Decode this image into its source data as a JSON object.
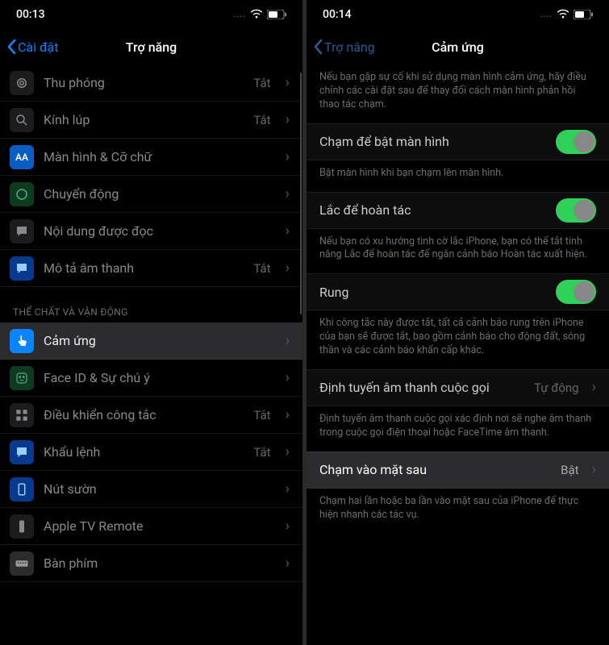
{
  "left": {
    "time": "00:13",
    "back": "Cài đặt",
    "title": "Trợ năng",
    "section_header": "THỂ CHẤT VÀ VẬN ĐỘNG",
    "rows": [
      {
        "icon": "zoom",
        "label": "Thu phóng",
        "value": "Tắt"
      },
      {
        "icon": "loup",
        "label": "Kính lúp",
        "value": "Tắt"
      },
      {
        "icon": "text",
        "label": "Màn hình & Cỡ chữ",
        "value": ""
      },
      {
        "icon": "motion",
        "label": "Chuyển động",
        "value": ""
      },
      {
        "icon": "spoken",
        "label": "Nội dung được đọc",
        "value": ""
      },
      {
        "icon": "audio",
        "label": "Mô tả âm thanh",
        "value": "Tắt"
      }
    ],
    "rows2": [
      {
        "icon": "touch",
        "label": "Cảm ứng",
        "value": "",
        "hl": true
      },
      {
        "icon": "face",
        "label": "Face ID & Sự chú ý",
        "value": ""
      },
      {
        "icon": "switch",
        "label": "Điều khiển công tắc",
        "value": "Tắt"
      },
      {
        "icon": "voice",
        "label": "Khẩu lệnh",
        "value": "Tắt"
      },
      {
        "icon": "side",
        "label": "Nút sườn",
        "value": ""
      },
      {
        "icon": "tv",
        "label": "Apple TV Remote",
        "value": ""
      },
      {
        "icon": "kb",
        "label": "Bàn phím",
        "value": ""
      }
    ]
  },
  "right": {
    "time": "00:14",
    "back": "Trợ năng",
    "title": "Cảm ứng",
    "intro": "Nếu bạn gặp sự cố khi sử dụng màn hình cảm ứng, hãy điều chỉnh các cài đặt sau để thay đổi cách màn hình phản hồi thao tác chạm.",
    "tap_wake_label": "Chạm để bật màn hình",
    "tap_wake_desc": "Bật màn hình khi bạn chạm lên màn hình.",
    "shake_label": "Lắc để hoàn tác",
    "shake_desc": "Nếu bạn có xu hướng tình cờ lắc iPhone, bạn có thể tắt tính năng Lắc để hoàn tác để ngăn cảnh báo Hoàn tác xuất hiện.",
    "vibe_label": "Rung",
    "vibe_desc": "Khi công tắc này được tắt, tất cả cảnh báo rung trên iPhone của bạn sẽ được tắt, bao gồm cảnh báo cho động đất, sóng thần và các cảnh báo khẩn cấp khác.",
    "route_label": "Định tuyến âm thanh cuộc gọi",
    "route_value": "Tự động",
    "route_desc": "Định tuyến âm thanh cuộc gọi xác định nơi sẽ nghe âm thanh trong cuộc gọi điện thoại hoặc FaceTime âm thanh.",
    "backtap_label": "Chạm vào mặt sau",
    "backtap_value": "Bật",
    "backtap_desc": "Chạm hai lần hoặc ba lần vào mặt sau của iPhone để thực hiện nhanh các tác vụ."
  }
}
